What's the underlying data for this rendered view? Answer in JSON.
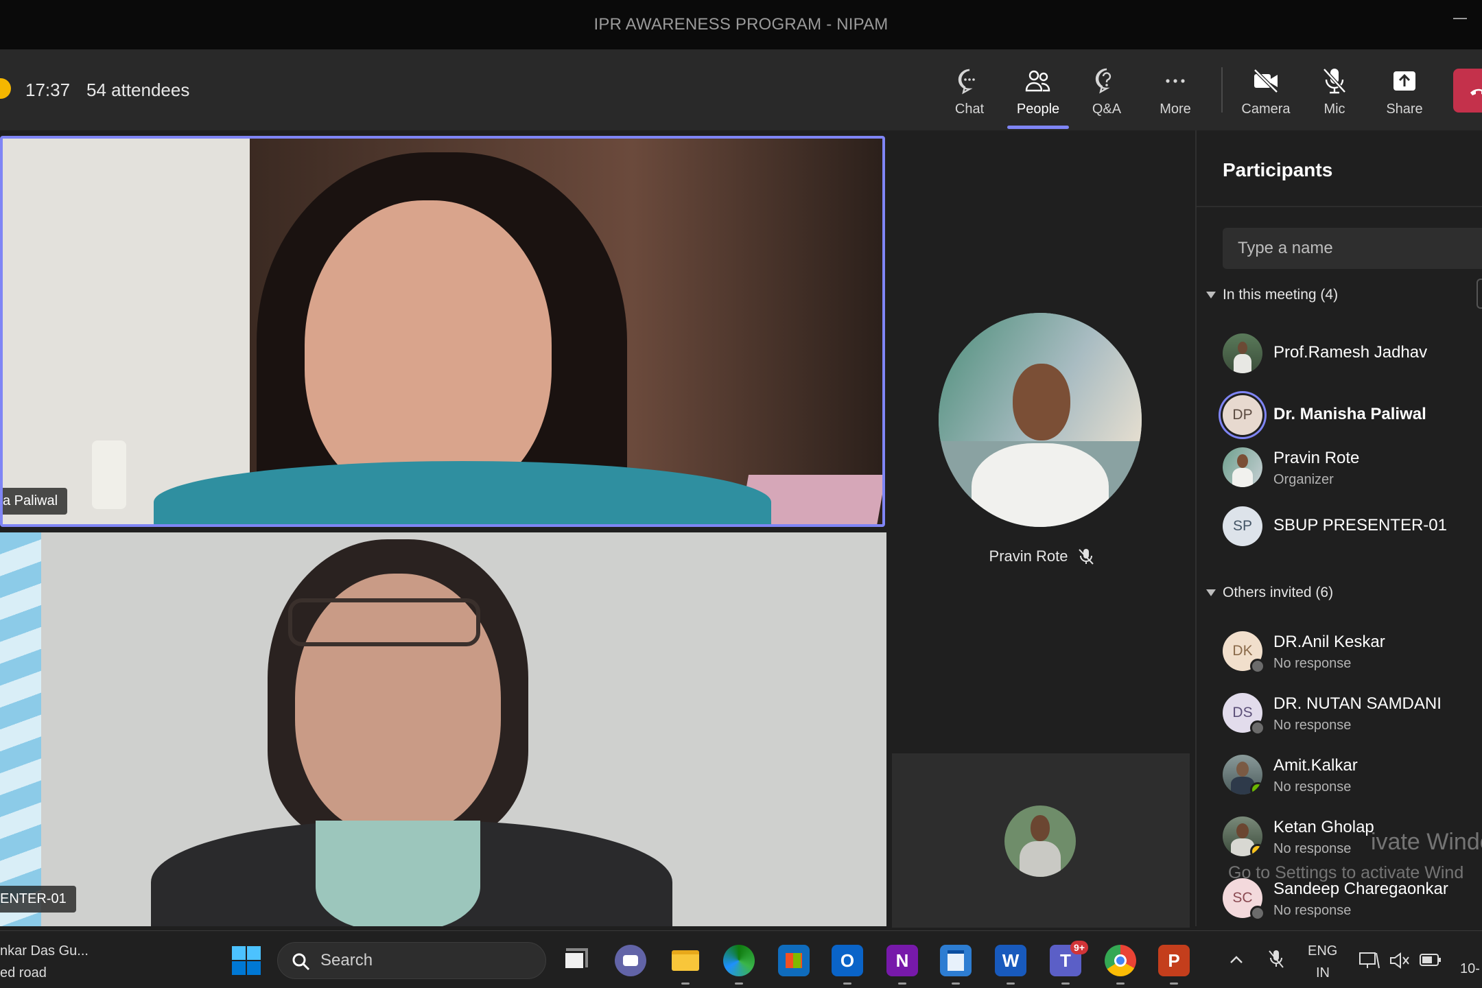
{
  "window": {
    "title": "IPR AWARENESS PROGRAM - NIPAM"
  },
  "meeting": {
    "timer": "17:37",
    "attendees": "54 attendees",
    "toolbar": {
      "chat": "Chat",
      "people": "People",
      "qa": "Q&A",
      "more": "More",
      "camera": "Camera",
      "mic": "Mic",
      "share": "Share"
    },
    "colors": {
      "accent": "#7f85f5",
      "leave": "#c4314b",
      "recording": "#f5b700"
    }
  },
  "stage": {
    "tile1_name": "a Paliwal",
    "tile2_name": "ENTER-01",
    "spotlight_name": "Pravin Rote"
  },
  "participants": {
    "title": "Participants",
    "search_placeholder": "Type a name",
    "in_meeting_header": "In this meeting (4)",
    "in_meeting": [
      {
        "name": "Prof.Ramesh Jadhav",
        "sub": ""
      },
      {
        "name": "Dr. Manisha Paliwal",
        "sub": "",
        "initials": "DP"
      },
      {
        "name": "Pravin Rote",
        "sub": "Organizer"
      },
      {
        "name": "SBUP PRESENTER-01",
        "sub": "",
        "initials": "SP"
      }
    ],
    "others_header": "Others invited (6)",
    "others": [
      {
        "name": "DR.Anil Keskar",
        "sub": "No response",
        "initials": "DK"
      },
      {
        "name": "DR. NUTAN SAMDANI",
        "sub": "No response",
        "initials": "DS"
      },
      {
        "name": "Amit.Kalkar",
        "sub": "No response"
      },
      {
        "name": "Ketan Gholap",
        "sub": "No response"
      },
      {
        "name": "Sandeep Charegaonkar",
        "sub": "No response",
        "initials": "SC"
      }
    ],
    "watermark_1": "ivate Windows",
    "watermark_2": "Go to Settings to activate Wind"
  },
  "taskbar": {
    "weather_line1": "nkar Das Gu...",
    "weather_line2": "ed road",
    "search_placeholder": "Search",
    "teams_badge": "9+",
    "lang_1": "ENG",
    "lang_2": "IN",
    "clock": "10-"
  }
}
